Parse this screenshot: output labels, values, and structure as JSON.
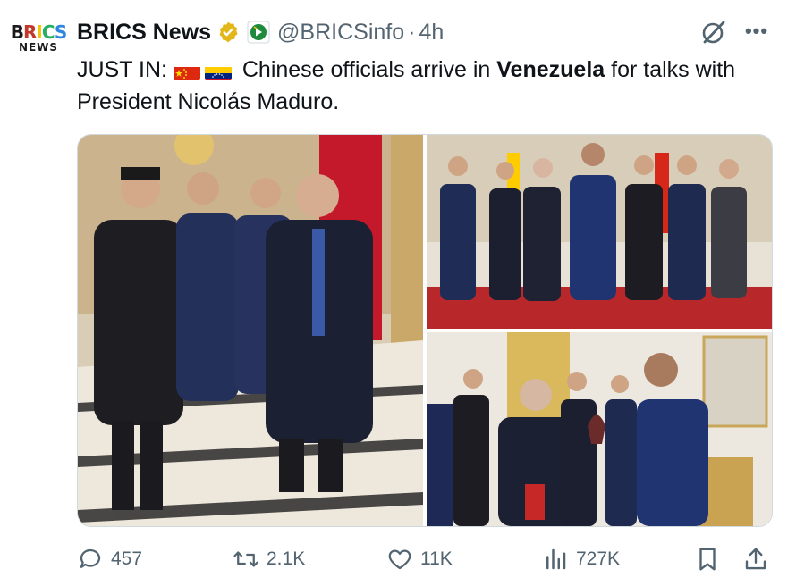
{
  "account": {
    "avatar_logo_top": "BRICS",
    "avatar_logo_bottom": "NEWS",
    "name": "BRICS News",
    "handle": "@BRICSinfo",
    "separator": "·",
    "time": "4h"
  },
  "tweet": {
    "prefix": "JUST IN:",
    "text_before_bold": "Chinese officials arrive in",
    "bold_word": "Venezuela",
    "text_after_bold": "for talks with President Nicolás Maduro.",
    "flags": [
      "china-flag",
      "venezuela-flag"
    ]
  },
  "media": {
    "photos": [
      "photo-officials-walking",
      "photo-group-portrait",
      "photo-gift-exchange"
    ]
  },
  "actions": {
    "replies": "457",
    "reposts": "2.1K",
    "likes": "11K",
    "views": "727K"
  },
  "icons": {
    "verified": "verified-badge-icon",
    "affiliate": "affiliate-badge-icon",
    "grok": "grok-icon",
    "more": "more-icon",
    "reply": "reply-icon",
    "repost": "repost-icon",
    "like": "heart-icon",
    "views": "views-icon",
    "bookmark": "bookmark-icon",
    "share": "share-icon"
  },
  "colors": {
    "text": "#0f1419",
    "secondary": "#536471",
    "verified_gold": "#e2b719",
    "border": "#cfd9de"
  }
}
